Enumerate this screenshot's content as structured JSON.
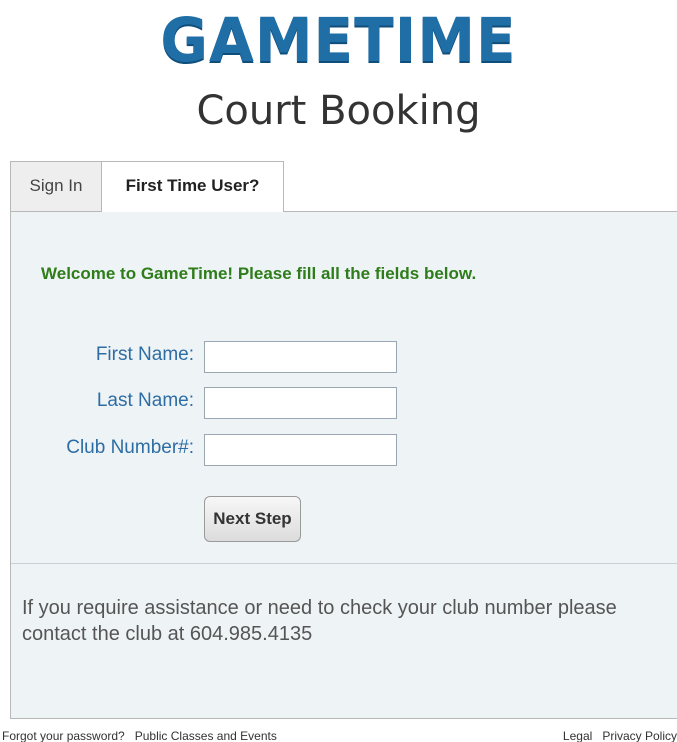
{
  "header": {
    "logo_text": "GAMETIME",
    "subtitle": "Court Booking"
  },
  "tabs": [
    {
      "label": "Sign In",
      "active": false
    },
    {
      "label": "First Time User?",
      "active": true
    }
  ],
  "form": {
    "welcome": "Welcome to GameTime! Please fill all the fields below.",
    "fields": [
      {
        "label": "First Name:",
        "value": ""
      },
      {
        "label": "Last Name:",
        "value": ""
      },
      {
        "label": "Club Number#:",
        "value": ""
      }
    ],
    "next_label": "Next Step"
  },
  "assistance_text": "If you require assistance or need to check your club number please contact the club at 604.985.4135",
  "footer": {
    "left_links": [
      "Forgot your password?",
      "Public Classes and Events"
    ],
    "right_links": [
      "Legal",
      "Privacy Policy"
    ]
  },
  "colors": {
    "logo": "#1f6ea6",
    "welcome": "#2e7d1a",
    "label": "#2d6da3",
    "panel_bg": "#eef3f6"
  }
}
